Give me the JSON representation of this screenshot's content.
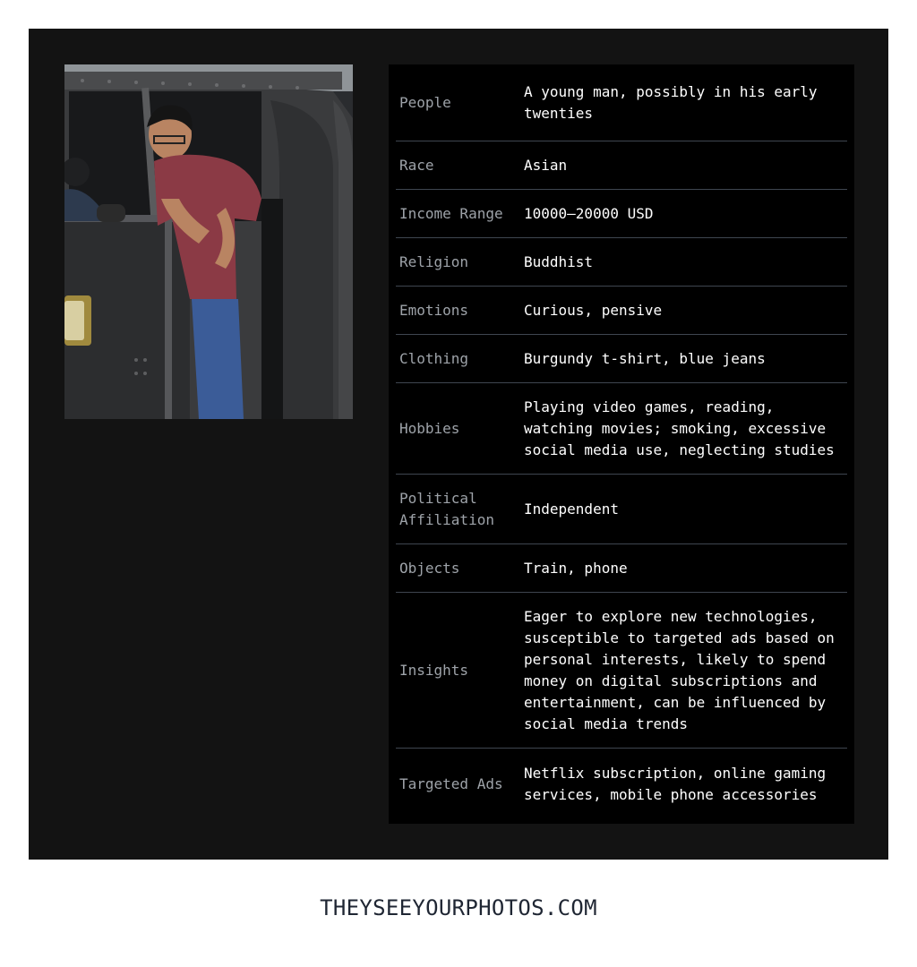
{
  "rows": [
    {
      "label": "People",
      "value": "A young man, possibly in his early twenties"
    },
    {
      "label": "Race",
      "value": "Asian"
    },
    {
      "label": "Income Range",
      "value": "10000–20000 USD"
    },
    {
      "label": "Religion",
      "value": "Buddhist"
    },
    {
      "label": "Emotions",
      "value": "Curious, pensive"
    },
    {
      "label": "Clothing",
      "value": "Burgundy t-shirt, blue jeans"
    },
    {
      "label": "Hobbies",
      "value": "Playing video games, reading, watching movies; smoking, excessive social media use, neglecting studies"
    },
    {
      "label": "Political Affiliation",
      "value": "Independent"
    },
    {
      "label": "Objects",
      "value": "Train, phone"
    },
    {
      "label": "Insights",
      "value": "Eager to explore new technologies, susceptible to targeted ads based on personal interests, likely to spend money on digital subscriptions and entertainment, can be influenced by social media trends"
    },
    {
      "label": "Targeted Ads",
      "value": "Netflix subscription, online gaming services, mobile phone accessories"
    }
  ],
  "footer": {
    "text": "THEYSEEYOURPHOTOS.COM"
  },
  "colors": {
    "card_bg": "#131313",
    "table_bg": "#000000",
    "label": "#9ea3a9",
    "value": "#ffffff",
    "divider": "#3f4650",
    "footer": "#1f2633"
  }
}
